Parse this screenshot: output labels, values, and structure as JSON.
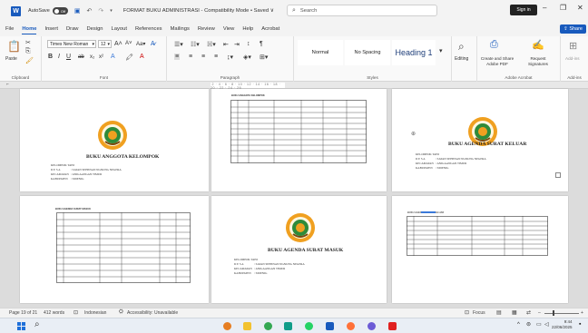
{
  "titlebar": {
    "autosave_label": "AutoSave",
    "autosave_state": "Off",
    "doc_title": "FORMAT BUKU ADMINISTRASI  -  Compatibility Mode  •  Saved ∨",
    "search_placeholder": "Search",
    "signin_label": "Sign in"
  },
  "tabs": [
    "File",
    "Home",
    "Insert",
    "Draw",
    "Design",
    "Layout",
    "References",
    "Mailings",
    "Review",
    "View",
    "Help",
    "Acrobat"
  ],
  "active_tab": "Home",
  "share_label": "Share",
  "ribbon": {
    "clipboard": {
      "paste_label": "Paste",
      "group_label": "Clipboard"
    },
    "font": {
      "font_name": "Times New Roman",
      "font_size": "12",
      "group_label": "Font"
    },
    "paragraph": {
      "group_label": "Paragraph"
    },
    "styles": {
      "normal": "Normal",
      "no_spacing": "No Spacing",
      "heading1": "Heading 1",
      "group_label": "Styles"
    },
    "editing": {
      "label": "Editing"
    },
    "adobe": {
      "create_share": "Create and Share Adobe PDF",
      "request_sig": "Request Signatures",
      "group_label": "Adobe Acrobat"
    },
    "addins": {
      "label": "Add-ins",
      "group_label": "Add-ins"
    }
  },
  "pages": {
    "p1": {
      "title": "BUKU ANGGOTA KELOMPOK",
      "fields": [
        [
          "KELOMPOK TANI",
          ":"
        ],
        [
          "D E S A",
          ": SATAN SEHENAN NGNUNG NEGERA"
        ],
        [
          "KECAMATAN",
          ": ANIGAANGAN TIMUR"
        ],
        [
          "KABUPATEN",
          ": SIDENIG"
        ]
      ]
    },
    "p2": {
      "table_title": "BUKU ANGGOTA KELOMPOK"
    },
    "p3": {
      "title": "BUKU AGENDA SURAT KELUAR",
      "fields": [
        [
          "KELOMPOK TANI",
          ":"
        ],
        [
          "D E S A",
          ": SATAN SEHENAN NGNUNG NEGERA"
        ],
        [
          "KECAMATAN",
          ": ANIGAANGAN TIMUR"
        ],
        [
          "KABUPATEN",
          ": SIDENIG"
        ]
      ]
    },
    "p4": {
      "table_title": "BUKU AGENDA SURAT MASUK"
    },
    "p5": {
      "title": "BUKU AGENDA SURAT MASUK",
      "fields": [
        [
          "KELOMPOK TANI",
          ":"
        ],
        [
          "D E S A",
          ": SATAN SEHENAN NGNUNG NEGERA"
        ],
        [
          "KECAMATAN",
          ": ANIGAANGAN TIMUR"
        ],
        [
          "KABUPATEN",
          ": SIDENIG"
        ]
      ]
    },
    "p6": {
      "table_title": "BUKU AGENDA SURAT KELUAR"
    }
  },
  "statusbar": {
    "page": "Page 19 of 21",
    "words": "412 words",
    "language": "Indonesian",
    "accessibility": "Accessibility: Unavailable",
    "focus": "Focus"
  },
  "taskbar": {
    "time": "9:44",
    "date": "22/06/2025"
  },
  "colors": {
    "word_blue": "#185abd",
    "logo_orange": "#f0a020",
    "logo_green": "#2e8b3a"
  }
}
